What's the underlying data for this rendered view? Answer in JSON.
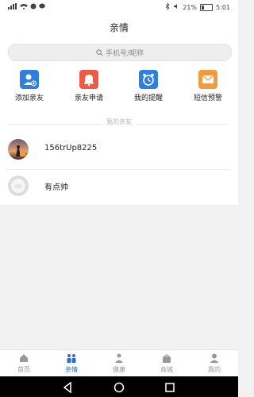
{
  "status_bar": {
    "battery_text": "21%",
    "time": "5:01"
  },
  "header": {
    "title": "亲情"
  },
  "search": {
    "placeholder": "手机号/昵称"
  },
  "quick_actions": [
    {
      "label": "添加亲友",
      "icon": "add-user-icon",
      "color": "#2f7fe0"
    },
    {
      "label": "亲友申请",
      "icon": "bell-icon",
      "color": "#ef5a45"
    },
    {
      "label": "我的提醒",
      "icon": "alarm-clock-icon",
      "color": "#2f7fe0"
    },
    {
      "label": "短信预警",
      "icon": "envelope-icon",
      "color": "#f39a3b"
    }
  ],
  "section": {
    "label": "我的亲友"
  },
  "friends": [
    {
      "name": "156trUp8225",
      "avatar": "photo-avatar"
    },
    {
      "name": "有点帅",
      "avatar": "default-avatar"
    }
  ],
  "bottom_nav": [
    {
      "label": "首页",
      "icon": "home-icon",
      "active": false
    },
    {
      "label": "亲情",
      "icon": "family-icon",
      "active": true
    },
    {
      "label": "健康",
      "icon": "health-icon",
      "active": false
    },
    {
      "label": "商城",
      "icon": "shop-icon",
      "active": false
    },
    {
      "label": "我的",
      "icon": "profile-icon",
      "active": false
    }
  ],
  "colors": {
    "accent": "#2a6fd6",
    "nav_inactive": "#999999"
  }
}
